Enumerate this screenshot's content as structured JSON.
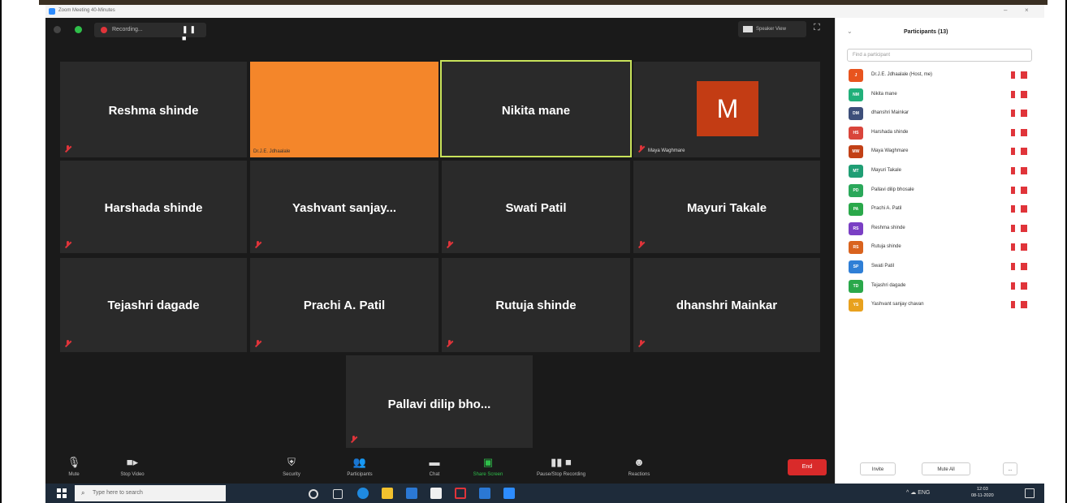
{
  "window": {
    "title": "Zoom Meeting 40-Minutes"
  },
  "topbar": {
    "recording_label": "Recording...",
    "recording_controls": "❚❚ ■",
    "view_button": "Speaker View"
  },
  "tiles": [
    {
      "name": "Reshma shinde",
      "caption": ""
    },
    {
      "name": "",
      "caption": "Dr.J.E. Jdhaalale"
    },
    {
      "name": "Nikita mane",
      "caption": ""
    },
    {
      "name": "",
      "avatar": "M",
      "caption": "Maya Waghmare"
    },
    {
      "name": "Harshada shinde",
      "caption": ""
    },
    {
      "name": "Yashvant  sanjay...",
      "caption": ""
    },
    {
      "name": "Swati Patil",
      "caption": ""
    },
    {
      "name": "Mayuri Takale",
      "caption": ""
    },
    {
      "name": "Tejashri dagade",
      "caption": ""
    },
    {
      "name": "Prachi A. Patil",
      "caption": ""
    },
    {
      "name": "Rutuja shinde",
      "caption": ""
    },
    {
      "name": "dhanshri Mainkar",
      "caption": ""
    },
    {
      "name": "Pallavi dilip bho...",
      "caption": ""
    }
  ],
  "toolbar": {
    "mute": "Mute",
    "stop_video": "Stop Video",
    "security": "Security",
    "participants": "Participants",
    "chat": "Chat",
    "share_screen": "Share Screen",
    "recording": "Pause/Stop Recording",
    "reactions": "Reactions",
    "end": "End"
  },
  "panel": {
    "title": "Participants (13)",
    "search_placeholder": "Find a participant",
    "participants": [
      {
        "initials": "J",
        "name": "Dr.J.E. Jdhaalale (Host, me)",
        "color": "#e8541e"
      },
      {
        "initials": "NM",
        "name": "Nikita mane",
        "color": "#21b07a"
      },
      {
        "initials": "DM",
        "name": "dhanshri Mainkar",
        "color": "#3d4f7a"
      },
      {
        "initials": "HS",
        "name": "Harshada shinde",
        "color": "#d9453b"
      },
      {
        "initials": "MW",
        "name": "Maya Waghmare",
        "color": "#c24016"
      },
      {
        "initials": "MT",
        "name": "Mayuri Takale",
        "color": "#1f9e74"
      },
      {
        "initials": "PD",
        "name": "Pallavi dilip bhosale",
        "color": "#2aa85a"
      },
      {
        "initials": "PA",
        "name": "Prachi A. Patil",
        "color": "#2aa84a"
      },
      {
        "initials": "RS",
        "name": "Reshma shinde",
        "color": "#7a3fc4"
      },
      {
        "initials": "RS",
        "name": "Rutuja shinde",
        "color": "#d9631e"
      },
      {
        "initials": "SP",
        "name": "Swati Patil",
        "color": "#2f7fd6"
      },
      {
        "initials": "TD",
        "name": "Tejashri dagade",
        "color": "#2aa84a"
      },
      {
        "initials": "YS",
        "name": "Yashvant sanjay chavan",
        "color": "#e8a11e"
      }
    ],
    "invite": "Invite",
    "mute_all": "Mute All",
    "more": "..."
  },
  "taskbar": {
    "search_placeholder": "Type here to search",
    "lang": "ENG",
    "time": "12:03",
    "date": "08-11-2020"
  },
  "colors": {
    "active_speaker": "#c8e25a",
    "tile_orange": "#f4862a",
    "end_red": "#d92a2a",
    "mute_red": "#e0343a"
  }
}
